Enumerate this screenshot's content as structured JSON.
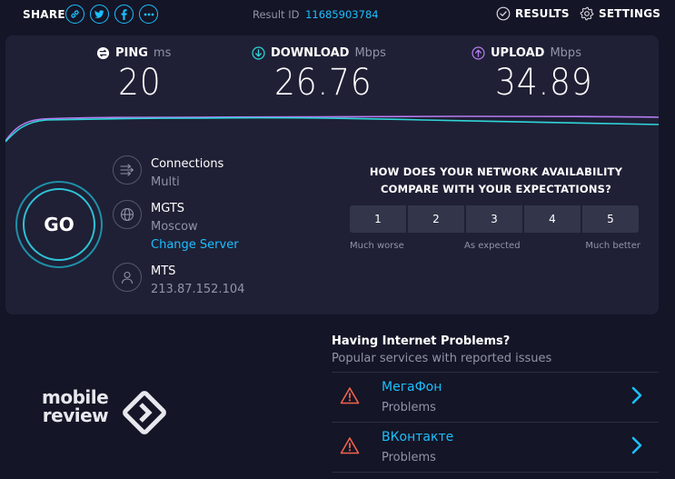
{
  "topbar": {
    "share_label": "SHARE",
    "share_icons": [
      "link-icon",
      "twitter-icon",
      "facebook-icon",
      "more-icon"
    ],
    "result_id_label": "Result ID",
    "result_id": "11685903784",
    "results_label": "RESULTS",
    "settings_label": "SETTINGS"
  },
  "metrics": {
    "ping": {
      "label": "PING",
      "unit": "ms",
      "value": "20",
      "icon": "ping-icon",
      "color": "#ffffff"
    },
    "download": {
      "label": "DOWNLOAD",
      "unit": "Mbps",
      "value": "26.76",
      "icon": "download-icon",
      "color": "#2fd6d9"
    },
    "upload": {
      "label": "UPLOAD",
      "unit": "Mbps",
      "value": "34.89",
      "icon": "upload-icon",
      "color": "#b57cf0"
    }
  },
  "go_button": {
    "label": "GO"
  },
  "server": {
    "connections_label": "Connections",
    "connections_value": "Multi",
    "host_name": "MGTS",
    "host_city": "Moscow",
    "change_server": "Change Server",
    "provider_name": "MTS",
    "provider_ip": "213.87.152.104"
  },
  "survey": {
    "question_line1": "HOW DOES YOUR NETWORK AVAILABILITY",
    "question_line2": "COMPARE WITH YOUR EXPECTATIONS?",
    "options": [
      "1",
      "2",
      "3",
      "4",
      "5"
    ],
    "label_low": "Much worse",
    "label_mid": "As expected",
    "label_high": "Much better"
  },
  "logo": {
    "line1": "mobile",
    "line2": "review"
  },
  "problems": {
    "title": "Having Internet Problems?",
    "subtitle": "Popular services with reported issues",
    "items": [
      {
        "name": "МегаФон",
        "status": "Problems"
      },
      {
        "name": "ВКонтакте",
        "status": "Problems"
      }
    ]
  },
  "colors": {
    "accent": "#1cbfff",
    "background": "#141526",
    "panel": "#1f2035",
    "warning": "#f0624d"
  }
}
